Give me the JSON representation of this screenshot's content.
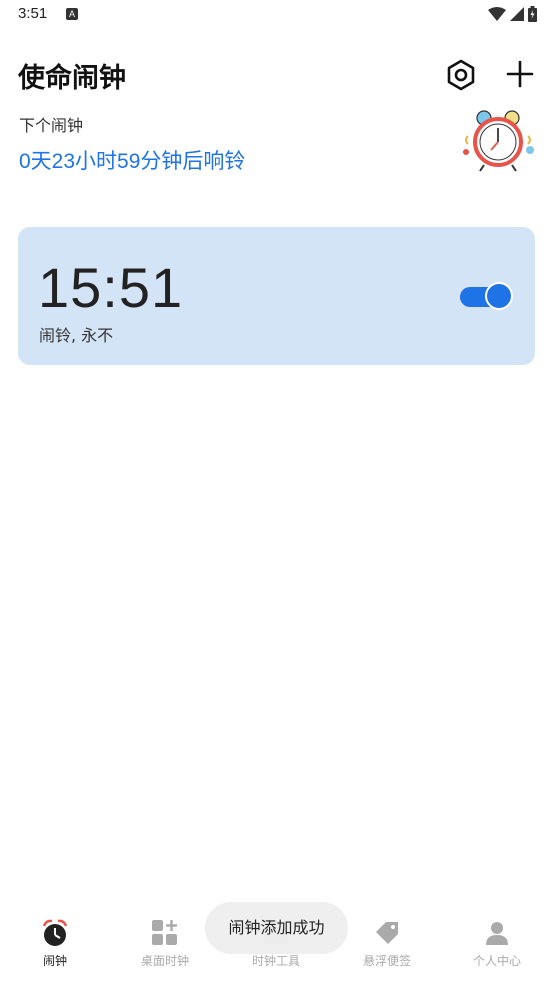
{
  "status_bar": {
    "time": "3:51",
    "a_icon": "A"
  },
  "header": {
    "title": "使命闹钟",
    "settings_icon": "hexagon-settings-icon",
    "add_icon": "plus-icon"
  },
  "next_alarm": {
    "label": "下个闹钟",
    "countdown": "0天23小时59分钟后响铃"
  },
  "alarms": [
    {
      "time": "15:51",
      "description": "闹铃, 永不",
      "enabled": true
    }
  ],
  "toast": "闹钟添加成功",
  "nav": [
    {
      "label": "闹钟",
      "icon": "alarm-clock-icon",
      "active": true
    },
    {
      "label": "桌面时钟",
      "icon": "widget-add-icon",
      "active": false
    },
    {
      "label": "时钟工具",
      "icon": "toolbox-icon",
      "active": false
    },
    {
      "label": "悬浮便签",
      "icon": "tag-icon",
      "active": false
    },
    {
      "label": "个人中心",
      "icon": "user-icon",
      "active": false
    }
  ],
  "colors": {
    "accent": "#1e74e6",
    "card_bg": "#d4e4f7",
    "alarm_icon_red": "#e8534a"
  }
}
